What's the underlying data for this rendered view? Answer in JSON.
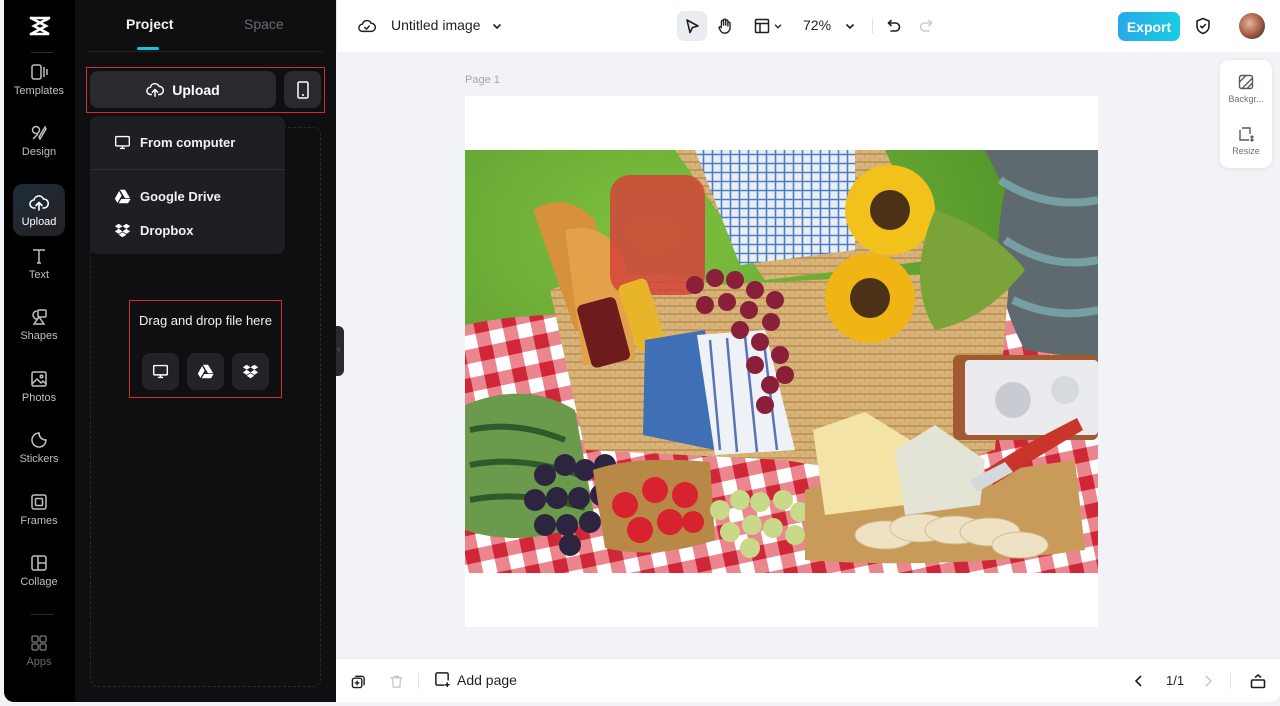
{
  "rail": {
    "items": [
      {
        "label": "Templates",
        "icon": "templates-icon"
      },
      {
        "label": "Design",
        "icon": "design-icon"
      },
      {
        "label": "Upload",
        "icon": "upload-cloud-icon",
        "active": true
      },
      {
        "label": "Text",
        "icon": "text-icon"
      },
      {
        "label": "Shapes",
        "icon": "shapes-icon"
      },
      {
        "label": "Photos",
        "icon": "photos-icon"
      },
      {
        "label": "Stickers",
        "icon": "stickers-icon"
      },
      {
        "label": "Frames",
        "icon": "frames-icon"
      },
      {
        "label": "Collage",
        "icon": "collage-icon"
      },
      {
        "label": "Apps",
        "icon": "apps-icon"
      }
    ]
  },
  "panel": {
    "tabs": [
      {
        "label": "Project",
        "active": true
      },
      {
        "label": "Space",
        "active": false
      }
    ],
    "upload_label": "Upload",
    "menu": {
      "items": [
        {
          "label": "From computer",
          "icon": "monitor-icon"
        },
        {
          "label": "Google Drive",
          "icon": "google-drive-icon"
        },
        {
          "label": "Dropbox",
          "icon": "dropbox-icon"
        }
      ]
    },
    "dropzone_text": "Drag and drop file here"
  },
  "topbar": {
    "title": "Untitled image",
    "zoom": "72%",
    "export_label": "Export"
  },
  "canvas": {
    "page_label": "Page 1",
    "image_description": "Picnic basket with bread, wine, grapes, sunflowers, watermelon, strawberries, cheese and crackers on red gingham cloth"
  },
  "side_panel": {
    "items": [
      {
        "label": "Backgr...",
        "icon": "background-icon"
      },
      {
        "label": "Resize",
        "icon": "resize-icon"
      }
    ]
  },
  "bottombar": {
    "add_page_label": "Add page",
    "page_indicator": "1/1"
  },
  "colors": {
    "accent": "#1fc0dc",
    "export_gradient_start": "#27a8ea",
    "export_gradient_end": "#17cde3",
    "highlight_border": "#d12a32"
  }
}
